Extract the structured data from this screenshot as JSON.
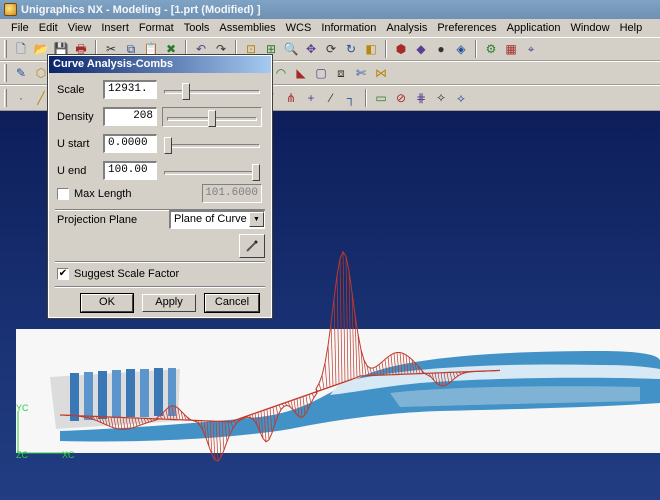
{
  "window": {
    "title": "Unigraphics NX - Modeling - [1.prt (Modified) ]"
  },
  "menu": [
    "File",
    "Edit",
    "View",
    "Insert",
    "Format",
    "Tools",
    "Assemblies",
    "WCS",
    "Information",
    "Analysis",
    "Preferences",
    "Application",
    "Window",
    "Help"
  ],
  "toolbars": {
    "row1": [
      "new-file-icon",
      "open-folder-icon",
      "save-icon",
      "print-icon",
      "sep",
      "cut-icon",
      "copy-icon",
      "paste-icon",
      "delete-icon",
      "sep",
      "undo-icon",
      "redo-icon",
      "sep",
      "fit-view-icon",
      "zoom-window-icon",
      "zoom-icon",
      "pan-icon",
      "rotate-icon",
      "refresh-icon",
      "shaded-icon",
      "sep",
      "render-style-icon",
      "view-cube-icon",
      "color-icon",
      "layer-icon",
      "sep",
      "tools-icon",
      "grid-icon",
      "snap-icon"
    ],
    "row2": [
      "sketch-icon",
      "feature-icon",
      "extrude-icon",
      "revolve-icon",
      "sweep-icon",
      "hole-icon",
      "sep",
      "block-icon",
      "cylinder-icon",
      "cone-icon",
      "sphere-icon",
      "sep",
      "surface-icon",
      "mesh-icon",
      "blend-icon",
      "chamfer-icon",
      "shell-icon",
      "offset-icon",
      "trim-icon",
      "sew-icon"
    ],
    "row3": [
      "point-icon",
      "line-icon",
      "arc-icon",
      "spline-icon",
      "sep",
      "curve-icon",
      "bridge-icon",
      "fillet-curve-icon",
      "sep",
      "project-icon",
      "intersect-icon",
      "extract-icon",
      "sep",
      "analysis-icon",
      "deviation-icon",
      "comb-icon",
      "cross-icon",
      "slash-icon",
      "corner-icon",
      "sep",
      "face-icon",
      "section-icon",
      "iso-icon",
      "highlight-icon",
      "reflect-icon"
    ]
  },
  "dialog": {
    "title": "Curve Analysis-Combs",
    "scale": {
      "label": "Scale",
      "value": "12931.",
      "slider": 0.2
    },
    "density": {
      "label": "Density",
      "value": "208",
      "slider": 0.5
    },
    "u_start": {
      "label": "U start",
      "value": "0.0000",
      "slider": 0.0
    },
    "u_end": {
      "label": "U end",
      "value": "100.00",
      "slider": 1.0
    },
    "max_length": {
      "label": "Max Length",
      "checked": false,
      "value": "101.6000"
    },
    "projection": {
      "label": "Projection Plane",
      "value": "Plane of Curve"
    },
    "suggest": {
      "label": "Suggest Scale Factor",
      "checked": true
    },
    "buttons": {
      "ok": "OK",
      "apply": "Apply",
      "cancel": "Cancel"
    }
  },
  "viewport": {
    "axis_labels": {
      "yc": "YC",
      "zc": "ZC",
      "xc": "XC"
    },
    "colors": {
      "background": "#14286a",
      "model": "#2e86c1",
      "comb": "#c0392b"
    }
  }
}
